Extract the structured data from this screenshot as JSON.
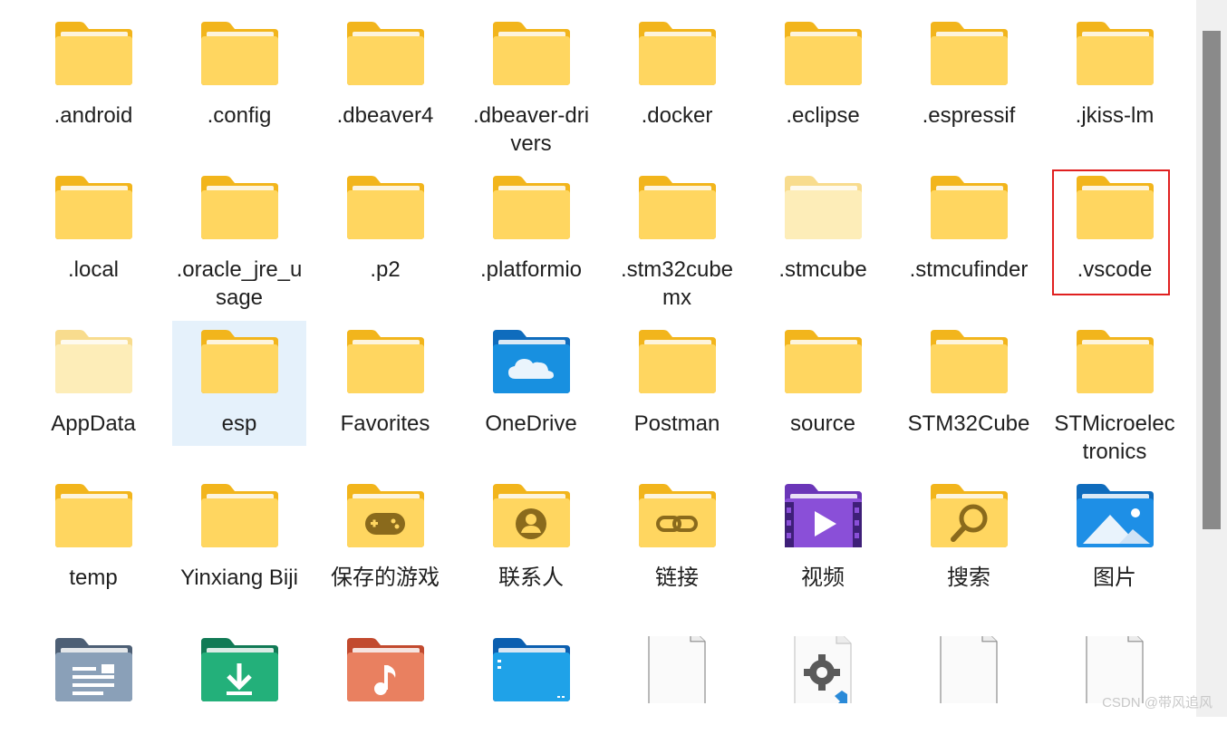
{
  "items": [
    {
      "name": "folder-android",
      "label": ".android",
      "icon": "folder-icon"
    },
    {
      "name": "folder-config",
      "label": ".config",
      "icon": "folder-icon"
    },
    {
      "name": "folder-dbeaver4",
      "label": ".dbeaver4",
      "icon": "folder-icon"
    },
    {
      "name": "folder-dbeaver-drivers",
      "label": ".dbeaver-drivers",
      "icon": "folder-icon"
    },
    {
      "name": "folder-docker",
      "label": ".docker",
      "icon": "folder-icon"
    },
    {
      "name": "folder-eclipse",
      "label": ".eclipse",
      "icon": "folder-icon"
    },
    {
      "name": "folder-espressif",
      "label": ".espressif",
      "icon": "folder-icon"
    },
    {
      "name": "folder-jkiss-lm",
      "label": ".jkiss-lm",
      "icon": "folder-icon"
    },
    {
      "name": "folder-local",
      "label": ".local",
      "icon": "folder-icon"
    },
    {
      "name": "folder-oracle-jre-usage",
      "label": ".oracle_jre_usage",
      "icon": "folder-icon"
    },
    {
      "name": "folder-p2",
      "label": ".p2",
      "icon": "folder-icon"
    },
    {
      "name": "folder-platformio",
      "label": ".platformio",
      "icon": "folder-icon"
    },
    {
      "name": "folder-stm32cubemx",
      "label": ".stm32cubemx",
      "icon": "folder-icon"
    },
    {
      "name": "folder-stmcube",
      "label": ".stmcube",
      "icon": "folder-hidden-icon"
    },
    {
      "name": "folder-stmcufinder",
      "label": ".stmcufinder",
      "icon": "folder-icon"
    },
    {
      "name": "folder-vscode",
      "label": ".vscode",
      "icon": "folder-icon"
    },
    {
      "name": "folder-appdata",
      "label": "AppData",
      "icon": "folder-hidden-icon"
    },
    {
      "name": "folder-esp",
      "label": "esp",
      "icon": "folder-icon"
    },
    {
      "name": "folder-favorites",
      "label": "Favorites",
      "icon": "folder-icon"
    },
    {
      "name": "folder-onedrive",
      "label": "OneDrive",
      "icon": "onedrive-folder-icon"
    },
    {
      "name": "folder-postman",
      "label": "Postman",
      "icon": "folder-icon"
    },
    {
      "name": "folder-source",
      "label": "source",
      "icon": "folder-icon"
    },
    {
      "name": "folder-stm32cube",
      "label": "STM32Cube",
      "icon": "folder-icon"
    },
    {
      "name": "folder-stmicroelectronics",
      "label": "STMicroelectronics",
      "icon": "folder-icon"
    },
    {
      "name": "folder-temp",
      "label": "temp",
      "icon": "folder-icon"
    },
    {
      "name": "folder-yinxiang-biji",
      "label": "Yinxiang Biji",
      "icon": "folder-icon"
    },
    {
      "name": "folder-saved-games",
      "label": "保存的游戏",
      "icon": "saved-games-folder-icon"
    },
    {
      "name": "folder-contacts",
      "label": "联系人",
      "icon": "contacts-folder-icon"
    },
    {
      "name": "folder-links",
      "label": "链接",
      "icon": "links-folder-icon"
    },
    {
      "name": "folder-videos",
      "label": "视频",
      "icon": "videos-folder-icon"
    },
    {
      "name": "folder-searches",
      "label": "搜索",
      "icon": "searches-folder-icon"
    },
    {
      "name": "folder-pictures",
      "label": "图片",
      "icon": "pictures-folder-icon"
    },
    {
      "name": "folder-documents",
      "label": "",
      "icon": "documents-folder-icon"
    },
    {
      "name": "folder-downloads",
      "label": "",
      "icon": "downloads-folder-icon"
    },
    {
      "name": "folder-music",
      "label": "",
      "icon": "music-folder-icon"
    },
    {
      "name": "folder-desktop",
      "label": "",
      "icon": "desktop-folder-icon"
    },
    {
      "name": "file-blank-1",
      "label": "",
      "icon": "blank-file-icon"
    },
    {
      "name": "file-vscode-settings",
      "label": "",
      "icon": "vscode-settings-file-icon"
    },
    {
      "name": "file-blank-2",
      "label": "",
      "icon": "blank-file-icon"
    },
    {
      "name": "file-blank-3",
      "label": "",
      "icon": "blank-file-icon"
    }
  ],
  "selected_item": "esp",
  "highlighted_item": ".vscode",
  "watermark": "CSDN @带风追风",
  "colors": {
    "folder_back": "#f3b71f",
    "folder_front": "#ffd75e",
    "selection": "#e5f1fb",
    "highlight_border": "#e02020"
  }
}
